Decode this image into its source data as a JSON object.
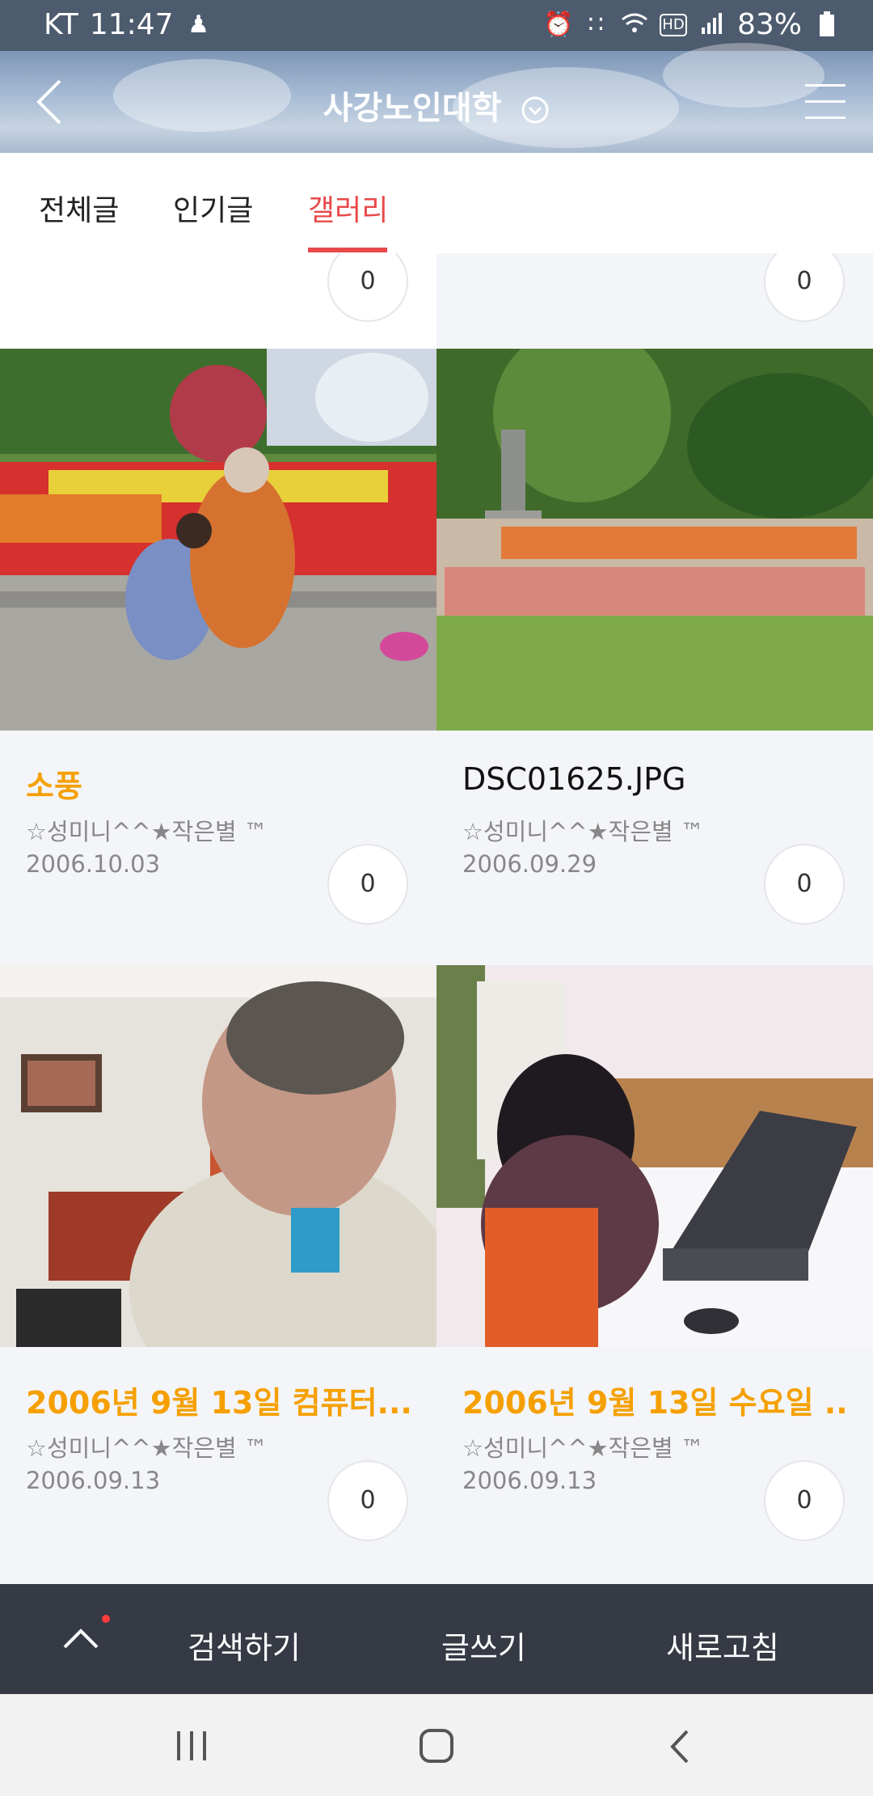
{
  "status_bar": {
    "carrier": "KT",
    "time": "11:47",
    "icons": [
      "person-icon",
      "alarm-icon",
      "bluetooth-icon",
      "wifi-icon",
      "hd-icon",
      "signal-icon"
    ],
    "battery": "83%"
  },
  "header": {
    "title": "사강노인대학",
    "back_icon": "back-chevron-icon",
    "menu_icon": "hamburger-menu-icon"
  },
  "tabs": [
    {
      "label": "전체글",
      "active": false
    },
    {
      "label": "인기글",
      "active": false
    },
    {
      "label": "갤러리",
      "active": true
    }
  ],
  "partial_row": {
    "left": {
      "comment_count": "0"
    },
    "right": {
      "comment_count": "0"
    }
  },
  "gallery": [
    {
      "title": "소풍",
      "title_color": "#f5a000",
      "author": "☆성미니^^★작은별 ™",
      "date": "2006.10.03",
      "comment_count": "0"
    },
    {
      "title": "DSC01625.JPG",
      "title_color": "#111111",
      "author": "☆성미니^^★작은별 ™",
      "date": "2006.09.29",
      "comment_count": "0"
    },
    {
      "title": "2006년 9월 13일 컴퓨터...",
      "title_color": "#f5a000",
      "author": "☆성미니^^★작은별 ™",
      "date": "2006.09.13",
      "comment_count": "0"
    },
    {
      "title": "2006년 9월 13일 수요일 ...",
      "title_color": "#f5a000",
      "author": "☆성미니^^★작은별 ™",
      "date": "2006.09.13",
      "comment_count": "0"
    }
  ],
  "action_bar": {
    "search": "검색하기",
    "write": "글쓰기",
    "refresh": "새로고침",
    "up_icon": "scroll-up-icon"
  },
  "nav_bar": {
    "icons": [
      "recent-apps-icon",
      "home-icon",
      "back-icon"
    ]
  },
  "colors": {
    "accent": "#e84a4a",
    "title_orange": "#f5a000",
    "action_bar_bg": "#353a45"
  }
}
